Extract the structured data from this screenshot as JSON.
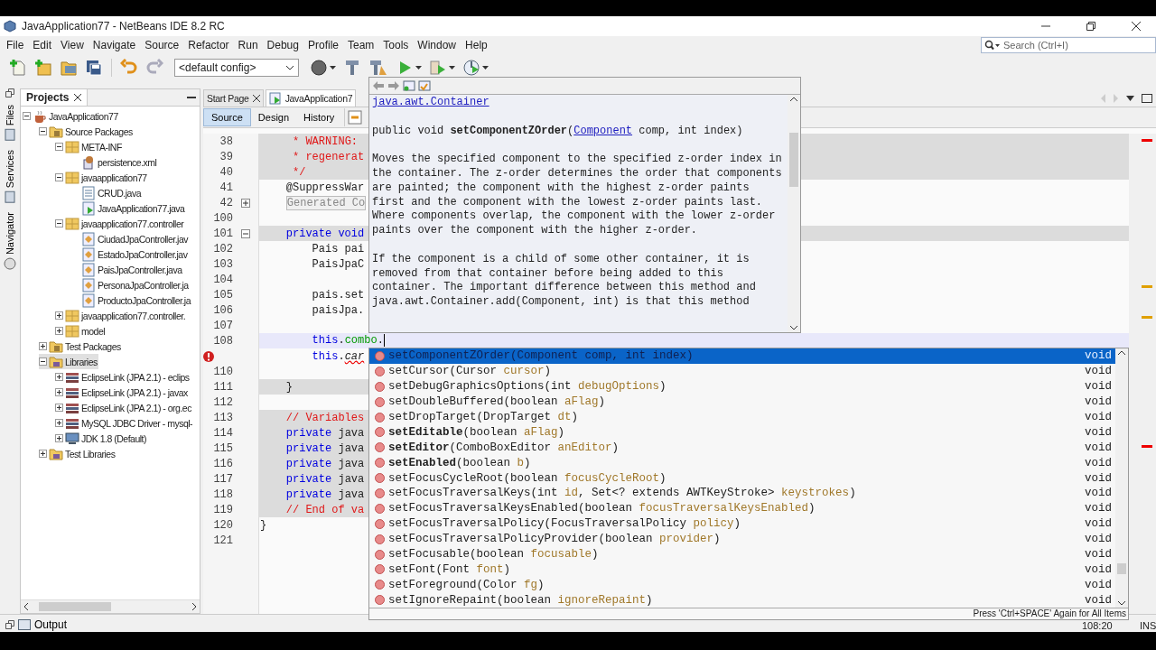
{
  "window": {
    "title": "JavaApplication77 - NetBeans IDE 8.2 RC"
  },
  "menu": [
    "File",
    "Edit",
    "View",
    "Navigate",
    "Source",
    "Refactor",
    "Run",
    "Debug",
    "Profile",
    "Team",
    "Tools",
    "Window",
    "Help"
  ],
  "search": {
    "placeholder": "Search (Ctrl+I)"
  },
  "toolbar": {
    "config": "<default config>"
  },
  "side_tabs": [
    "Files",
    "Services",
    "Navigator"
  ],
  "projects": {
    "title": "Projects",
    "tree": [
      {
        "label": "JavaApplication77",
        "kind": "project",
        "expanded": true,
        "selected": false,
        "children": [
          {
            "label": "Source Packages",
            "kind": "source-folder",
            "expanded": true,
            "selected": false,
            "children": [
              {
                "label": "META-INF",
                "kind": "package",
                "expanded": true,
                "selected": false,
                "children": [
                  {
                    "label": "persistence.xml",
                    "kind": "xml-file",
                    "selected": false
                  }
                ]
              },
              {
                "label": "javaapplication77",
                "kind": "package",
                "expanded": true,
                "selected": false,
                "children": [
                  {
                    "label": "CRUD.java",
                    "kind": "java-file",
                    "selected": false
                  },
                  {
                    "label": "JavaApplication77.java",
                    "kind": "main-file",
                    "selected": false
                  }
                ]
              },
              {
                "label": "javaapplication77.controller",
                "kind": "package",
                "expanded": true,
                "selected": false,
                "children": [
                  {
                    "label": "CiudadJpaController.jav",
                    "kind": "class-file",
                    "selected": false
                  },
                  {
                    "label": "EstadoJpaController.jav",
                    "kind": "class-file",
                    "selected": false
                  },
                  {
                    "label": "PaisJpaController.java",
                    "kind": "class-file",
                    "selected": false
                  },
                  {
                    "label": "PersonaJpaController.ja",
                    "kind": "class-file",
                    "selected": false
                  },
                  {
                    "label": "ProductoJpaController.ja",
                    "kind": "class-file",
                    "selected": false
                  }
                ]
              },
              {
                "label": "javaapplication77.controller.",
                "kind": "package",
                "expanded": false,
                "selected": false
              },
              {
                "label": "model",
                "kind": "package",
                "expanded": false,
                "selected": false
              }
            ]
          },
          {
            "label": "Test Packages",
            "kind": "source-folder",
            "expanded": false,
            "selected": false
          },
          {
            "label": "Libraries",
            "kind": "library-folder",
            "expanded": true,
            "selected": true,
            "children": [
              {
                "label": "EclipseLink (JPA 2.1) - eclips",
                "kind": "library",
                "expanded": false,
                "selected": false
              },
              {
                "label": "EclipseLink (JPA 2.1) - javax",
                "kind": "library",
                "expanded": false,
                "selected": false
              },
              {
                "label": "EclipseLink (JPA 2.1) - org.ec",
                "kind": "library",
                "expanded": false,
                "selected": false
              },
              {
                "label": "MySQL JDBC Driver - mysql-",
                "kind": "library",
                "expanded": false,
                "selected": false
              },
              {
                "label": "JDK 1.8 (Default)",
                "kind": "jdk",
                "expanded": false,
                "selected": false
              }
            ]
          },
          {
            "label": "Test Libraries",
            "kind": "library-folder",
            "expanded": false,
            "selected": false
          }
        ]
      }
    ]
  },
  "editor": {
    "tabs": [
      {
        "label": "Start Page",
        "selected": false
      },
      {
        "label": "JavaApplication7",
        "selected": true
      }
    ],
    "views": [
      {
        "label": "Source",
        "selected": true
      },
      {
        "label": "Design",
        "selected": false
      },
      {
        "label": "History",
        "selected": false
      }
    ],
    "lines": [
      {
        "number": "38",
        "guarded": true,
        "current": false,
        "error": false,
        "tokens": [
          {
            "text": "     * WARNING:",
            "kind": "comment"
          }
        ]
      },
      {
        "number": "39",
        "guarded": true,
        "current": false,
        "error": false,
        "tokens": [
          {
            "text": "     * regenerat",
            "kind": "comment"
          }
        ]
      },
      {
        "number": "40",
        "guarded": true,
        "current": false,
        "error": false,
        "tokens": [
          {
            "text": "     */",
            "kind": "comment"
          }
        ]
      },
      {
        "number": "41",
        "guarded": false,
        "current": false,
        "error": false,
        "tokens": [
          {
            "text": "    @SuppressWar",
            "kind": "plain"
          }
        ]
      },
      {
        "number": "42",
        "guarded": false,
        "current": false,
        "error": false,
        "expanded": false,
        "tokens": [
          {
            "text": "    Generated Co",
            "kind": "folded"
          }
        ]
      },
      {
        "number": "100",
        "guarded": false,
        "current": false,
        "error": false
      },
      {
        "number": "101",
        "guarded": true,
        "current": false,
        "error": false,
        "expanded": true,
        "tokens": [
          {
            "text": "    private void",
            "kind": "keyword"
          }
        ]
      },
      {
        "number": "102",
        "guarded": false,
        "current": false,
        "error": false,
        "tokens": [
          {
            "text": "        Pais pai",
            "kind": "plain"
          }
        ]
      },
      {
        "number": "103",
        "guarded": false,
        "current": false,
        "error": false,
        "tokens": [
          {
            "text": "        PaisJpaC",
            "kind": "plain"
          }
        ]
      },
      {
        "number": "104",
        "guarded": false,
        "current": false,
        "error": false
      },
      {
        "number": "105",
        "guarded": false,
        "current": false,
        "error": false,
        "tokens": [
          {
            "text": "        pais.set",
            "kind": "plain"
          }
        ]
      },
      {
        "number": "106",
        "guarded": false,
        "current": false,
        "error": false,
        "tokens": [
          {
            "text": "        paisJpa.",
            "kind": "plain"
          }
        ]
      },
      {
        "number": "107",
        "guarded": false,
        "current": false,
        "error": false
      },
      {
        "number": "108",
        "guarded": false,
        "current": true,
        "error": false,
        "tokens": [
          {
            "text": "        this",
            "kind": "keyword"
          },
          {
            "text": ".",
            "kind": "plain"
          },
          {
            "text": "combo",
            "kind": "field"
          },
          {
            "text": ".",
            "kind": "plain"
          }
        ]
      },
      {
        "guarded": false,
        "current": false,
        "error": true,
        "tokens": [
          {
            "text": "        this",
            "kind": "keyword"
          },
          {
            "text": ".",
            "kind": "plain"
          },
          {
            "text": "car",
            "kind": "error"
          }
        ]
      },
      {
        "number": "110",
        "guarded": false,
        "current": false,
        "error": false
      },
      {
        "number": "111",
        "guarded": true,
        "current": false,
        "error": false,
        "tokens": [
          {
            "text": "    }",
            "kind": "plain"
          }
        ]
      },
      {
        "number": "112",
        "guarded": false,
        "current": false,
        "error": false
      },
      {
        "number": "113",
        "guarded": true,
        "current": false,
        "error": false,
        "tokens": [
          {
            "text": "    // Variables",
            "kind": "comment"
          }
        ]
      },
      {
        "number": "114",
        "guarded": true,
        "current": false,
        "error": false,
        "tokens": [
          {
            "text": "    private",
            "kind": "keyword"
          },
          {
            "text": " java",
            "kind": "plain"
          }
        ]
      },
      {
        "number": "115",
        "guarded": true,
        "current": false,
        "error": false,
        "tokens": [
          {
            "text": "    private",
            "kind": "keyword"
          },
          {
            "text": " java",
            "kind": "plain"
          }
        ]
      },
      {
        "number": "116",
        "guarded": true,
        "current": false,
        "error": false,
        "tokens": [
          {
            "text": "    private",
            "kind": "keyword"
          },
          {
            "text": " java",
            "kind": "plain"
          }
        ]
      },
      {
        "number": "117",
        "guarded": true,
        "current": false,
        "error": false,
        "tokens": [
          {
            "text": "    private",
            "kind": "keyword"
          },
          {
            "text": " java",
            "kind": "plain"
          }
        ]
      },
      {
        "number": "118",
        "guarded": true,
        "current": false,
        "error": false,
        "tokens": [
          {
            "text": "    private",
            "kind": "keyword"
          },
          {
            "text": " java",
            "kind": "plain"
          }
        ]
      },
      {
        "number": "119",
        "guarded": true,
        "current": false,
        "error": false,
        "tokens": [
          {
            "text": "    // End of va",
            "kind": "comment"
          }
        ]
      },
      {
        "number": "120",
        "guarded": false,
        "current": false,
        "error": false,
        "tokens": [
          {
            "text": "}",
            "kind": "plain"
          }
        ]
      },
      {
        "number": "121",
        "guarded": false,
        "current": false,
        "error": false
      }
    ]
  },
  "javadoc": {
    "link": "java.awt.Container",
    "signature": {
      "before": "public void **setComponentZOrder**(",
      "link": "Component",
      "after": " comp, int index)"
    },
    "paragraphs": [
      "Moves the specified component to the specified z-order index in the container. The z-order determines the order that components are painted; the component with the highest z-order paints first and the component with the lowest z-order paints last. Where components overlap, the component with the lower z-order paints over the component with the higher z-order.",
      "If the component is a child of some other container, it is removed from that container before being added to this container. The important difference between this method and java.awt.Container.add(Component, int) is that this method"
    ]
  },
  "completion": {
    "items": [
      {
        "name": "setComponentZOrder",
        "bold": false,
        "selected": true,
        "returns": "void",
        "args": [
          {
            "text": "(Component ",
            "kind": "type"
          },
          {
            "text": "comp",
            "kind": "param"
          },
          {
            "text": ", int ",
            "kind": "type"
          },
          {
            "text": "index",
            "kind": "param"
          },
          {
            "text": ")",
            "kind": "type"
          }
        ]
      },
      {
        "name": "setCursor",
        "bold": false,
        "selected": false,
        "returns": "void",
        "args": [
          {
            "text": "(Cursor ",
            "kind": "type"
          },
          {
            "text": "cursor",
            "kind": "param"
          },
          {
            "text": ")",
            "kind": "type"
          }
        ]
      },
      {
        "name": "setDebugGraphicsOptions",
        "bold": false,
        "selected": false,
        "returns": "void",
        "args": [
          {
            "text": "(int ",
            "kind": "type"
          },
          {
            "text": "debugOptions",
            "kind": "param"
          },
          {
            "text": ")",
            "kind": "type"
          }
        ]
      },
      {
        "name": "setDoubleBuffered",
        "bold": false,
        "selected": false,
        "returns": "void",
        "args": [
          {
            "text": "(boolean ",
            "kind": "type"
          },
          {
            "text": "aFlag",
            "kind": "param"
          },
          {
            "text": ")",
            "kind": "type"
          }
        ]
      },
      {
        "name": "setDropTarget",
        "bold": false,
        "selected": false,
        "returns": "void",
        "args": [
          {
            "text": "(DropTarget ",
            "kind": "type"
          },
          {
            "text": "dt",
            "kind": "param"
          },
          {
            "text": ")",
            "kind": "type"
          }
        ]
      },
      {
        "name": "setEditable",
        "bold": true,
        "selected": false,
        "returns": "void",
        "args": [
          {
            "text": "(boolean ",
            "kind": "type"
          },
          {
            "text": "aFlag",
            "kind": "param"
          },
          {
            "text": ")",
            "kind": "type"
          }
        ]
      },
      {
        "name": "setEditor",
        "bold": true,
        "selected": false,
        "returns": "void",
        "args": [
          {
            "text": "(ComboBoxEditor ",
            "kind": "type"
          },
          {
            "text": "anEditor",
            "kind": "param"
          },
          {
            "text": ")",
            "kind": "type"
          }
        ]
      },
      {
        "name": "setEnabled",
        "bold": true,
        "selected": false,
        "returns": "void",
        "args": [
          {
            "text": "(boolean ",
            "kind": "type"
          },
          {
            "text": "b",
            "kind": "param"
          },
          {
            "text": ")",
            "kind": "type"
          }
        ]
      },
      {
        "name": "setFocusCycleRoot",
        "bold": false,
        "selected": false,
        "returns": "void",
        "args": [
          {
            "text": "(boolean ",
            "kind": "type"
          },
          {
            "text": "focusCycleRoot",
            "kind": "param"
          },
          {
            "text": ")",
            "kind": "type"
          }
        ]
      },
      {
        "name": "setFocusTraversalKeys",
        "bold": false,
        "selected": false,
        "returns": "void",
        "args": [
          {
            "text": "(int ",
            "kind": "type"
          },
          {
            "text": "id",
            "kind": "param"
          },
          {
            "text": ", Set<? extends AWTKeyStroke> ",
            "kind": "type"
          },
          {
            "text": "keystrokes",
            "kind": "param"
          },
          {
            "text": ")",
            "kind": "type"
          }
        ]
      },
      {
        "name": "setFocusTraversalKeysEnabled",
        "bold": false,
        "selected": false,
        "returns": "void",
        "args": [
          {
            "text": "(boolean ",
            "kind": "type"
          },
          {
            "text": "focusTraversalKeysEnabled",
            "kind": "param"
          },
          {
            "text": ")",
            "kind": "type"
          }
        ]
      },
      {
        "name": "setFocusTraversalPolicy",
        "bold": false,
        "selected": false,
        "returns": "void",
        "args": [
          {
            "text": "(FocusTraversalPolicy ",
            "kind": "type"
          },
          {
            "text": "policy",
            "kind": "param"
          },
          {
            "text": ")",
            "kind": "type"
          }
        ]
      },
      {
        "name": "setFocusTraversalPolicyProvider",
        "bold": false,
        "selected": false,
        "returns": "void",
        "args": [
          {
            "text": "(boolean ",
            "kind": "type"
          },
          {
            "text": "provider",
            "kind": "param"
          },
          {
            "text": ")",
            "kind": "type"
          }
        ]
      },
      {
        "name": "setFocusable",
        "bold": false,
        "selected": false,
        "returns": "void",
        "args": [
          {
            "text": "(boolean ",
            "kind": "type"
          },
          {
            "text": "focusable",
            "kind": "param"
          },
          {
            "text": ")",
            "kind": "type"
          }
        ]
      },
      {
        "name": "setFont",
        "bold": false,
        "selected": false,
        "returns": "void",
        "args": [
          {
            "text": "(Font ",
            "kind": "type"
          },
          {
            "text": "font",
            "kind": "param"
          },
          {
            "text": ")",
            "kind": "type"
          }
        ]
      },
      {
        "name": "setForeground",
        "bold": false,
        "selected": false,
        "returns": "void",
        "args": [
          {
            "text": "(Color ",
            "kind": "type"
          },
          {
            "text": "fg",
            "kind": "param"
          },
          {
            "text": ")",
            "kind": "type"
          }
        ]
      },
      {
        "name": "setIgnoreRepaint",
        "bold": false,
        "selected": false,
        "returns": "void",
        "args": [
          {
            "text": "(boolean ",
            "kind": "type"
          },
          {
            "text": "ignoreRepaint",
            "kind": "param"
          },
          {
            "text": ")",
            "kind": "type"
          }
        ]
      }
    ],
    "footer": "Press 'Ctrl+SPACE' Again for All Items"
  },
  "status_bar": {
    "output": "Output",
    "position": "108:20",
    "mode": "INS"
  }
}
